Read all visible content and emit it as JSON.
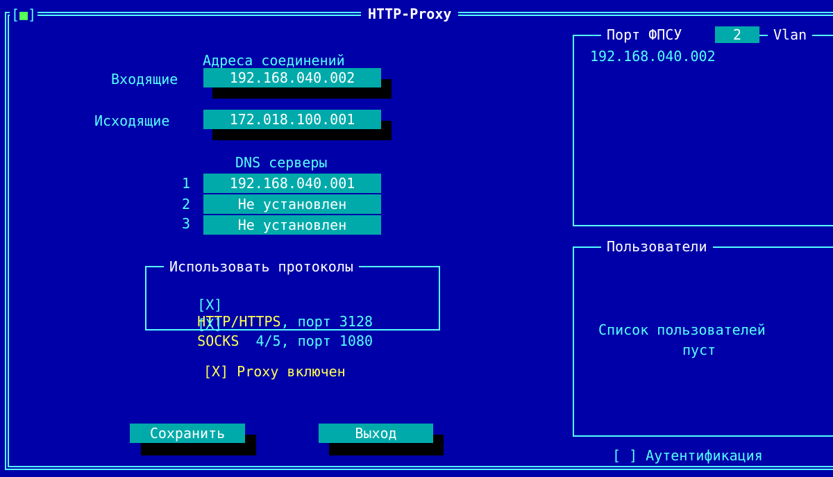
{
  "window": {
    "title": "HTTP-Proxy",
    "close_glyph": "■"
  },
  "addresses": {
    "heading": "Адреса соединений",
    "incoming_label": "Входящие",
    "incoming_value": "192.168.040.002",
    "outgoing_label": "Исходящие",
    "outgoing_value": "172.018.100.001"
  },
  "dns": {
    "heading": "DNS серверы",
    "servers": [
      {
        "num": "1",
        "value": "192.168.040.001"
      },
      {
        "num": "2",
        "value": "Не установлен"
      },
      {
        "num": "3",
        "value": "Не установлен"
      }
    ]
  },
  "protocols": {
    "legend": "Использовать протоколы",
    "items": [
      {
        "check": "[X]",
        "name": "HTTP/HTTPS",
        "rest": ", порт 3128"
      },
      {
        "check": "[X]",
        "name": "SOCKS",
        "rest": "  4/5, порт 1080"
      }
    ]
  },
  "proxy_enabled": "[X] Proxy включен",
  "buttons": {
    "save": "Сохранить",
    "exit": "Выход"
  },
  "port_panel": {
    "label": "Порт ФПСУ",
    "port_value": "2",
    "vlan_label": "Vlan",
    "addresses": [
      "192.168.040.002"
    ]
  },
  "users_panel": {
    "label": "Пользователи",
    "empty_line1": "Список пользователей",
    "empty_line2": "пуст"
  },
  "auth_checkbox": "[ ] Аутентификация",
  "colors": {
    "background": "#0000a8",
    "field": "#00aaaa",
    "accent": "#55ffff",
    "highlight": "#ffff55"
  }
}
